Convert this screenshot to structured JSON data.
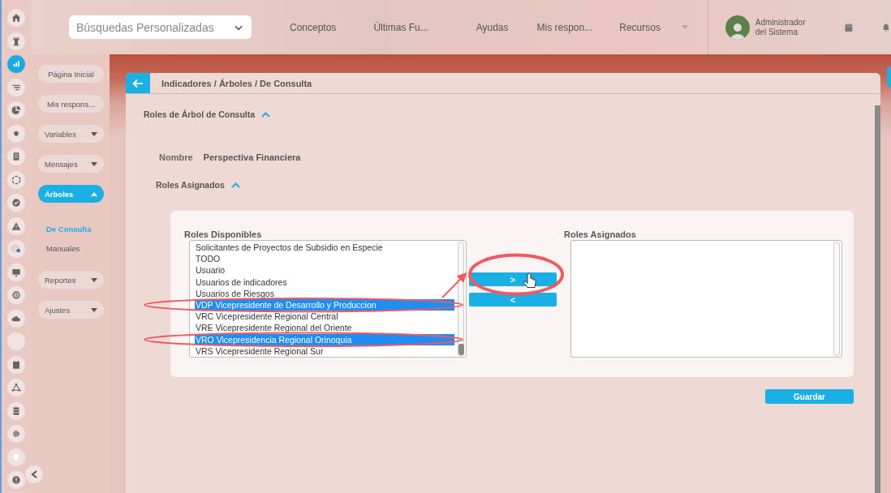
{
  "rail": [
    {
      "selected": false
    },
    {
      "selected": false
    },
    {
      "selected": true
    },
    {
      "selected": false
    },
    {
      "selected": false
    },
    {
      "selected": false
    },
    {
      "selected": false
    },
    {
      "selected": false
    },
    {
      "selected": false
    },
    {
      "selected": false
    },
    {
      "selected": false
    },
    {
      "selected": false
    },
    {
      "selected": false
    },
    {
      "selected": false
    },
    {
      "selected": false
    },
    {
      "selected": false
    },
    {
      "selected": false
    },
    {
      "selected": false
    },
    {
      "selected": false
    },
    {
      "selected": false
    },
    {
      "selected": false
    }
  ],
  "topbar": {
    "search_dropdown": {
      "value": "Búsquedas Personalizadas"
    },
    "menu": [
      {
        "label": "Conceptos",
        "kind": "link"
      },
      {
        "label": "Últimas Fu...",
        "kind": "link"
      },
      {
        "label": "Ayudas",
        "kind": "link"
      },
      {
        "label": "Mis respon...",
        "kind": "link"
      },
      {
        "label": "Recursos",
        "kind": "dropdown"
      }
    ],
    "user": {
      "name": "Administrador del Sistema"
    }
  },
  "sidenav": {
    "items": [
      {
        "label": "Página Inicial",
        "kind": "button",
        "expanded": false
      },
      {
        "label": "Mis respons...",
        "kind": "button",
        "expanded": false
      },
      {
        "label": "Variables",
        "kind": "dropdown",
        "expanded": false
      },
      {
        "label": "Mensajes",
        "kind": "dropdown",
        "expanded": false
      },
      {
        "label": "Árboles",
        "kind": "dropdown",
        "expanded": true,
        "children": [
          {
            "label": "De Consulta",
            "selected": true
          },
          {
            "label": "Manuales",
            "selected": false
          }
        ]
      },
      {
        "label": "Reportes",
        "kind": "dropdown",
        "expanded": false
      },
      {
        "label": "Ajustes",
        "kind": "dropdown",
        "expanded": false
      }
    ]
  },
  "panel": {
    "breadcrumb": "Indicadores / Árboles / De Consulta",
    "section": {
      "title": "Roles de Árbol de Consulta",
      "expanded": true
    },
    "fields": [
      {
        "label": "Nombre",
        "value": "Perspectiva Financiera"
      }
    ],
    "subsection": {
      "title": "Roles Asignados",
      "expanded": true
    },
    "available": {
      "label": "Roles Disponibles",
      "items": [
        {
          "text": "Solicitantes de Proyectos de Subsidio en Especie",
          "selected": false
        },
        {
          "text": "TODO",
          "selected": false
        },
        {
          "text": "Usuario",
          "selected": false
        },
        {
          "text": "Usuarios de indicadores",
          "selected": false
        },
        {
          "text": "Usuarios de Riesgos",
          "selected": false
        },
        {
          "text": "VDP Vicepresidente de Desarrollo y Produccion",
          "selected": true
        },
        {
          "text": "VRC Vicepresidente Regional Central",
          "selected": false
        },
        {
          "text": "VRE Vicepresidente Regional del Oriente",
          "selected": false
        },
        {
          "text": "VRO Vicepresidencia Regional Orinoquia",
          "selected": true
        },
        {
          "text": "VRS Vicepresidente Regional Sur",
          "selected": false
        }
      ]
    },
    "move_buttons": [
      ">",
      "<"
    ],
    "assigned": {
      "label": "Roles Asignados"
    },
    "save_button": "Guardar"
  }
}
